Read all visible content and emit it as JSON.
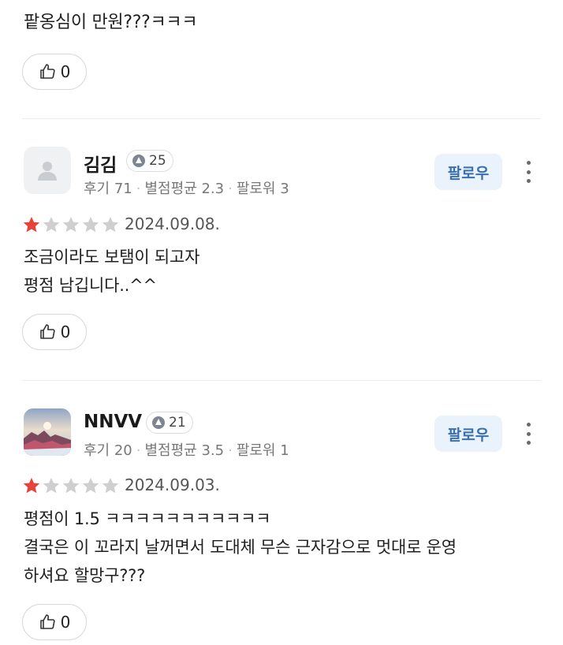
{
  "top_review": {
    "text": "팥옹심이 만원???ㅋㅋㅋ",
    "like_count": "0"
  },
  "reviews": [
    {
      "name": "김김",
      "level": "25",
      "meta_reviews": "후기 71",
      "meta_avg": "별점평균 2.3",
      "meta_followers": "팔로워 3",
      "follow_label": "팔로우",
      "rating": 1,
      "date": "2024.09.08.",
      "text": "조금이라도 보탬이 되고자\n평점 남깁니다..^^",
      "like_count": "0",
      "avatar": "default-user-icon"
    },
    {
      "name": "NNVV",
      "level": "21",
      "meta_reviews": "후기 20",
      "meta_avg": "별점평균 3.5",
      "meta_followers": "팔로워 1",
      "follow_label": "팔로우",
      "rating": 1,
      "date": "2024.09.03.",
      "text": "평점이 1.5 ㅋㅋㅋㅋㅋㅋㅋㅋㅋㅋㅋ\n결국은 이 꼬라지 날꺼면서 도대체 무슨 근자감으로 멋대로 운영\n하셔요 할망구???",
      "like_count": "0",
      "avatar": "landscape-photo"
    }
  ],
  "colors": {
    "star_filled": "#e8413a",
    "star_empty": "#cfcfcf",
    "follow_bg": "#eaf2fb",
    "follow_text": "#3a6fb0"
  }
}
